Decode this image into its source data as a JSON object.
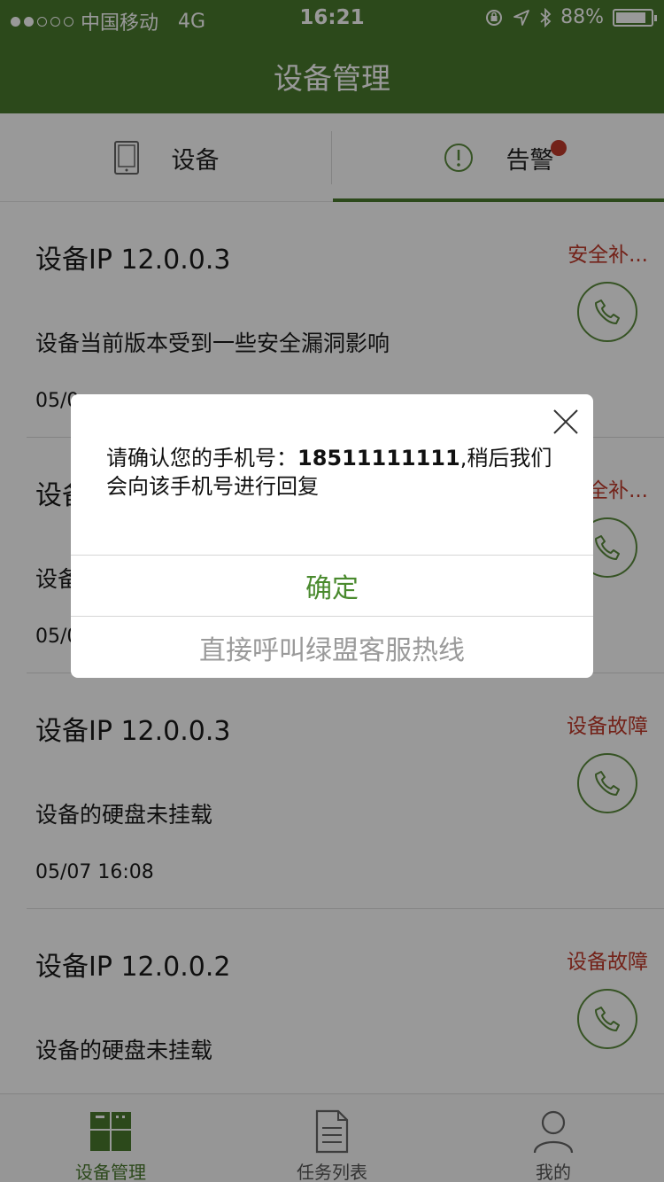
{
  "status_bar": {
    "carrier": "中国移动",
    "network": "4G",
    "time": "16:21",
    "battery": "88%",
    "battery_level": 0.88
  },
  "nav": {
    "title": "设备管理"
  },
  "tabs": [
    {
      "label": "设备",
      "icon": "tablet-icon"
    },
    {
      "label": "告警",
      "icon": "alert-circle-icon",
      "badge": true
    }
  ],
  "items": [
    {
      "ip": "设备IP 12.0.0.3",
      "desc": "设备当前版本受到一些安全漏洞影响",
      "time": "05/0",
      "status": "安全补..."
    },
    {
      "ip": "设备IP",
      "desc": "设备",
      "time": "05/0",
      "status": "安全补..."
    },
    {
      "ip": "设备IP 12.0.0.3",
      "desc": "设备的硬盘未挂载",
      "time": "05/07 16:08",
      "status": "设备故障"
    },
    {
      "ip": "设备IP 12.0.0.2",
      "desc": "设备的硬盘未挂载",
      "time": "",
      "status": "设备故障"
    }
  ],
  "bottom_nav": [
    {
      "label": "设备管理",
      "icon": "device-manage-icon",
      "active": true
    },
    {
      "label": "任务列表",
      "icon": "document-icon",
      "active": false
    },
    {
      "label": "我的",
      "icon": "person-icon",
      "active": false
    }
  ],
  "dialog": {
    "message_prefix": "请确认您的手机号：",
    "phone": "18511111111",
    "message_suffix": ",稍后我们会向该手机号进行回复",
    "confirm_label": "确定",
    "call_label": "直接呼叫绿盟客服热线"
  },
  "colors": {
    "brand": "#4a7a2e",
    "alert": "#c0392b",
    "muted": "#9a9a9a"
  }
}
